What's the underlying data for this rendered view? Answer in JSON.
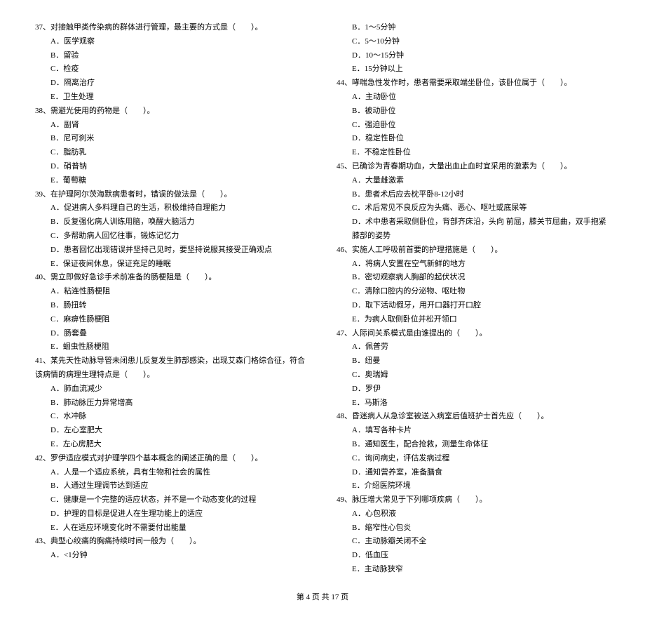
{
  "left": {
    "q37": {
      "stem": "37、对接触甲类传染病的群体进行管理，最主要的方式是（　　）。",
      "a": "A．医学观察",
      "b": "B．留验",
      "c": "C．检疫",
      "d": "D．隔离治疗",
      "e": "E．卫生处理"
    },
    "q38": {
      "stem": "38、需避光使用的药物是（　　）。",
      "a": "A．副肾",
      "b": "B．尼可刹米",
      "c": "C．脂肪乳",
      "d": "D．硝普钠",
      "e": "E．葡萄糖"
    },
    "q39": {
      "stem": "39、在护理阿尔茨海默病患者时，错误的做法是（　　）。",
      "a": "A．促进病人多料理自己的生活，积极维持自理能力",
      "b": "B．反复强化病人训练用脑，唤醒大脑活力",
      "c": "C．多帮助病人回忆往事，锻炼记忆力",
      "d": "D．患者回忆出现错误并坚持己见时，要坚持说服其接受正确观点",
      "e": "E．保证夜间休息，保证充足的睡眠"
    },
    "q40": {
      "stem": "40、需立即做好急诊手术前准备的肠梗阻是（　　）。",
      "a": "A．粘连性肠梗阻",
      "b": "B．肠扭转",
      "c": "C．麻痹性肠梗阻",
      "d": "D．肠套叠",
      "e": "E．蛔虫性肠梗阻"
    },
    "q41": {
      "stem": "41、某先天性动脉导管未闭患儿反复发生肺部感染，出现艾森门格综合征，符合该病情的病理生理特点是（　　）。",
      "a": "A．肺血流减少",
      "b": "B．肺动脉压力异常增高",
      "c": "C．水冲脉",
      "d": "D．左心室肥大",
      "e": "E．左心房肥大"
    },
    "q42": {
      "stem": "42、罗伊适应模式对护理学四个基本概念的阐述正确的是（　　）。",
      "a": "A．人是一个适应系统，具有生物和社会的属性",
      "b": "B．人通过生理调节达到适应",
      "c": "C．健康是一个完整的适应状态，并不是一个动态变化的过程",
      "d": "D．护理的目标是促进人在生理功能上的适应",
      "e": "E．人在适应环境变化时不需要付出能量"
    },
    "q43": {
      "stem": "43、典型心绞痛的胸痛持续时间一般为（　　）。",
      "a": "A．<1分钟"
    }
  },
  "right": {
    "q43r": {
      "b": "B．1～5分钟",
      "c": "C．5～10分钟",
      "d": "D．10～15分钟",
      "e": "E．15分钟以上"
    },
    "q44": {
      "stem": "44、哮喘急性发作时，患者需要采取端坐卧位，该卧位属于（　　）。",
      "a": "A．主动卧位",
      "b": "B．被动卧位",
      "c": "C．强迫卧位",
      "d": "D．稳定性卧位",
      "e": "E．不稳定性卧位"
    },
    "q45": {
      "stem": "45、已确诊为青春期功血，大量出血止血时宜采用的激素为（　　）。",
      "a": "A．大量雌激素",
      "b": "B．患者术后应去枕平卧8-12小时",
      "c": "C．术后常见不良反应为头痛、恶心、呕吐或底尿等",
      "d": "D．术中患者采取侧卧位，背部齐床沿，头向 前屈，膝关节屈曲，双手抱紧膝部的姿势"
    },
    "q46": {
      "stem": "46、实施人工呼吸前首要的护理措施是（　　）。",
      "a": "A．将病人安置在空气新鲜的地方",
      "b": "B．密切观察病人胸部的起伏状况",
      "c": "C．清除口腔内的分泌物、呕吐物",
      "d": "D．取下活动假牙，用开口器打开口腔",
      "e": "E．为病人取侧卧位并松开领口"
    },
    "q47": {
      "stem": "47、人际间关系模式是由谁提出的（　　）。",
      "a": "A．佩普劳",
      "b": "B．纽曼",
      "c": "C．奥瑞姆",
      "d": "D．罗伊",
      "e": "E．马斯洛"
    },
    "q48": {
      "stem": "48、昏迷病人从急诊室被送入病室后值班护士首先应（　　）。",
      "a": "A．填写各种卡片",
      "b": "B．通知医生，配合抢救，测量生命体征",
      "c": "C．询问病史，评估发病过程",
      "d": "D．通知营养室，准备膳食",
      "e": "E．介绍医院环境"
    },
    "q49": {
      "stem": "49、脉压增大常见于下列哪项疾病（　　）。",
      "a": "A．心包积液",
      "b": "B．缩窄性心包炎",
      "c": "C．主动脉瓣关闭不全",
      "d": "D．低血压",
      "e": "E．主动脉狭窄"
    }
  },
  "footer": "第 4 页 共 17 页"
}
